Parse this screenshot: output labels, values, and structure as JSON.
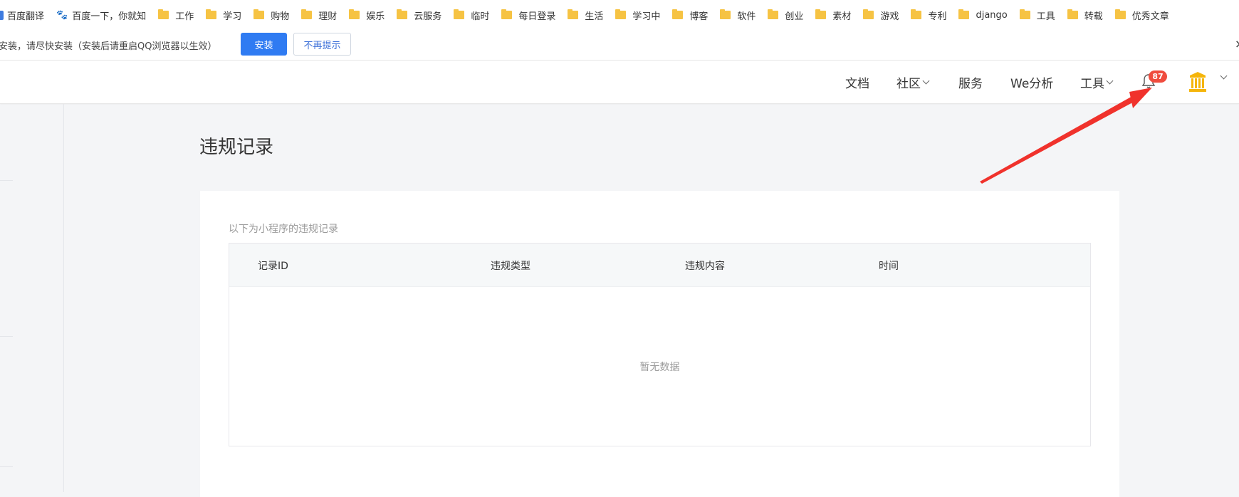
{
  "bookmarks": [
    {
      "label": "百度翻译",
      "icon": "translate-icon"
    },
    {
      "label": "百度一下，你就知",
      "icon": "baidu-paw-icon"
    },
    {
      "label": "工作",
      "icon": "folder-icon"
    },
    {
      "label": "学习",
      "icon": "folder-icon"
    },
    {
      "label": "购物",
      "icon": "folder-icon"
    },
    {
      "label": "理财",
      "icon": "folder-icon"
    },
    {
      "label": "娱乐",
      "icon": "folder-icon"
    },
    {
      "label": "云服务",
      "icon": "folder-icon"
    },
    {
      "label": "临时",
      "icon": "folder-icon"
    },
    {
      "label": "每日登录",
      "icon": "folder-icon"
    },
    {
      "label": "生活",
      "icon": "folder-icon"
    },
    {
      "label": "学习中",
      "icon": "folder-icon"
    },
    {
      "label": "博客",
      "icon": "folder-icon"
    },
    {
      "label": "软件",
      "icon": "folder-icon"
    },
    {
      "label": "创业",
      "icon": "folder-icon"
    },
    {
      "label": "素材",
      "icon": "folder-icon"
    },
    {
      "label": "游戏",
      "icon": "folder-icon"
    },
    {
      "label": "专利",
      "icon": "folder-icon"
    },
    {
      "label": "django",
      "icon": "folder-icon"
    },
    {
      "label": "工具",
      "icon": "folder-icon"
    },
    {
      "label": "转载",
      "icon": "folder-icon"
    },
    {
      "label": "优秀文章",
      "icon": "folder-icon"
    }
  ],
  "infobar": {
    "message": "安装，请尽快安装（安装后请重启QQ浏览器以生效）",
    "install_label": "安装",
    "dismiss_label": "不再提示",
    "close_glyph": "×"
  },
  "nav": {
    "docs": "文档",
    "community": "社区",
    "services": "服务",
    "analytics": "We分析",
    "tools": "工具",
    "notification_count": "87"
  },
  "page": {
    "title": "违规记录",
    "description": "以下为小程序的违规记录",
    "columns": [
      "记录ID",
      "违规类型",
      "违规内容",
      "时间"
    ],
    "empty_text": "暂无数据"
  },
  "colors": {
    "primary": "#2f7bf2",
    "badge": "#f04c3e",
    "annotation_arrow": "#f0322c",
    "folder": "#f6c343",
    "avatar": "#f5b50a"
  }
}
